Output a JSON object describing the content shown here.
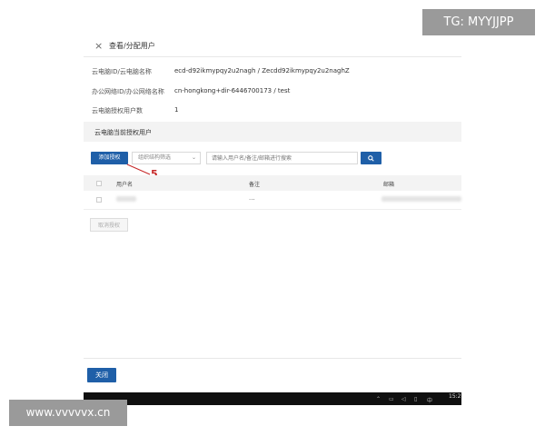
{
  "dialog": {
    "title": "查看/分配用户",
    "close_icon": "×"
  },
  "info": [
    {
      "label": "云电脑ID/云电脑名称",
      "value": "ecd-d92ikmypqy2u2nagh / Zecdd92ikmypqy2u2naghZ"
    },
    {
      "label": "办公网络ID/办公网络名称",
      "value": "cn-hongkong+dir-6446700173 / test"
    },
    {
      "label": "云电脑授权用户数",
      "value": "1"
    }
  ],
  "section": {
    "title": "云电脑当前授权用户"
  },
  "toolbar": {
    "add_label": "添加授权",
    "org_select": "组织结构筛选",
    "search_placeholder": "请输入用户名/备注/邮箱进行搜索"
  },
  "annotation": {
    "number": "5",
    "color": "#c62828"
  },
  "table": {
    "headers": [
      "用户名",
      "备注",
      "邮箱"
    ],
    "rows": [
      {
        "note": "..."
      }
    ]
  },
  "cancel_label": "取消授权",
  "footer": {
    "close_label": "关闭"
  },
  "taskbar": {
    "clock": "15:2"
  },
  "watermarks": {
    "top": "TG: MYYJJPP",
    "bottom": "www.vvvvvx.cn"
  },
  "colors": {
    "primary": "#1f5fa8",
    "header_bg": "#f3f3f3"
  }
}
